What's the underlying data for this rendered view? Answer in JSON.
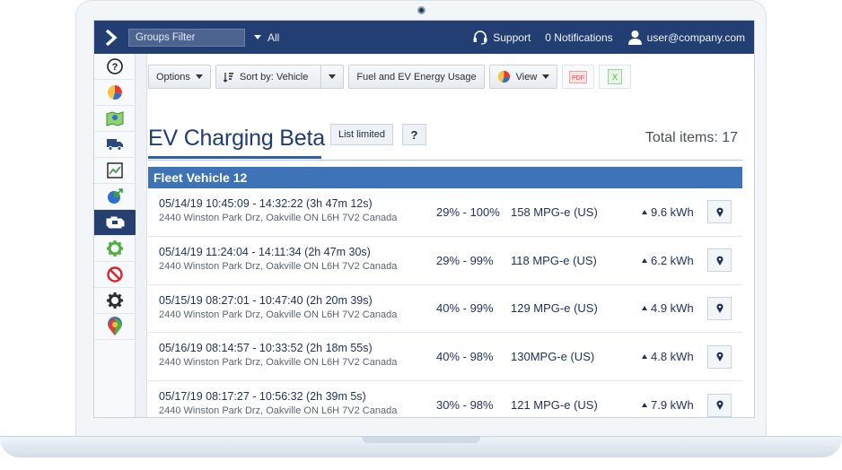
{
  "topbar": {
    "groups_filter_placeholder": "Groups Filter",
    "groups_dropdown_value": "All",
    "support_label": "Support",
    "notifications_label": "0 Notifications",
    "user_label": "user@company.com",
    "bg_color": "#233e72"
  },
  "sidebar": {
    "items": [
      {
        "icon": "help-icon"
      },
      {
        "icon": "pie-chart-icon"
      },
      {
        "icon": "map-icon"
      },
      {
        "icon": "truck-icon"
      },
      {
        "icon": "trend-chart-icon"
      },
      {
        "icon": "pie-arrow-icon"
      },
      {
        "icon": "engine-icon",
        "active": true
      },
      {
        "icon": "gear-green-icon"
      },
      {
        "icon": "no-entry-icon"
      },
      {
        "icon": "gear-icon"
      },
      {
        "icon": "marketplace-pin-icon"
      }
    ]
  },
  "toolbar": {
    "options_label": "Options",
    "sort_label": "Sort by: Vehicle",
    "report_label": "Fuel and EV Energy Usage",
    "view_label": "View",
    "pdf_icon": "pdf-icon",
    "excel_icon": "excel-icon"
  },
  "page": {
    "title": "EV Charging Beta",
    "list_limited_label": "List limited",
    "help_label": "?",
    "total_items": "Total items: 17"
  },
  "group": {
    "name": "Fleet Vehicle 12"
  },
  "rows": [
    {
      "datetime": "05/14/19 10:45:09 - 14:32:22 (3h 47m 12s)",
      "address": "2440 Winston Park Drz, Oakville ON L6H 7V2 Canada",
      "range": "29% - 100%",
      "mpg": "158 MPG-e (US)",
      "kwh": "9.6 kWh"
    },
    {
      "datetime": "05/14/19 11:24:04 - 14:11:34 (2h 47m 30s)",
      "address": "2440 Winston Park Drz, Oakville ON L6H 7V2 Canada",
      "range": "29% - 99%",
      "mpg": "118 MPG-e (US)",
      "kwh": "6.2 kWh"
    },
    {
      "datetime": "05/15/19 08:27:01 - 10:47:40 (2h 20m 39s)",
      "address": "2440 Winston Park Drz, Oakville ON L6H 7V2 Canada",
      "range": "40% - 99%",
      "mpg": "129 MPG-e (US)",
      "kwh": "4.9 kWh"
    },
    {
      "datetime": "05/16/19 08:14:57 - 10:33:52 (2h 18m 55s)",
      "address": "2440 Winston Park Drz, Oakville ON L6H 7V2 Canada",
      "range": "40% - 98%",
      "mpg": "130MPG-e (US)",
      "kwh": "4.8 kWh"
    },
    {
      "datetime": "05/17/19 08:17:27 - 10:56:32 (2h 39m 5s)",
      "address": "2440 Winston Park Drz, Oakville ON L6H 7V2 Canada",
      "range": "30% - 98%",
      "mpg": "121 MPG-e (US)",
      "kwh": "7.9 kWh"
    }
  ]
}
